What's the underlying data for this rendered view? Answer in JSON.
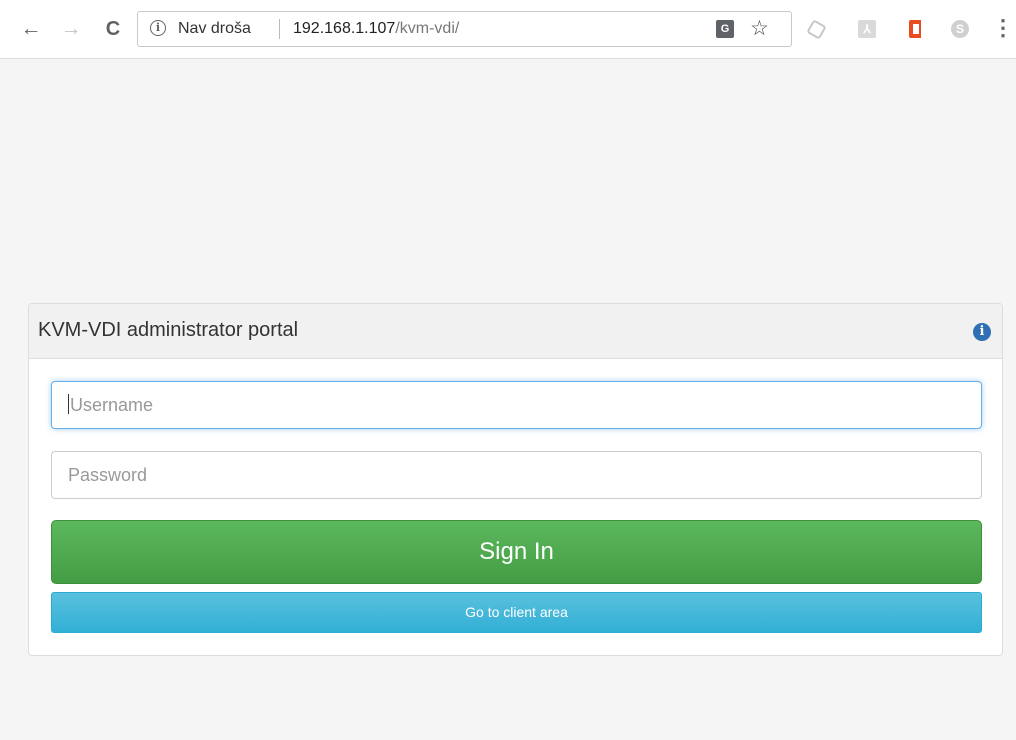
{
  "browser": {
    "back_icon": "←",
    "forward_icon": "→",
    "reload_icon": "C",
    "security_label": "Nav droša",
    "url_host": "192.168.1.107",
    "url_path": "/kvm-vdi/",
    "star_icon": "☆",
    "menu_icon": "⋮",
    "extensions": [
      "cube-extension-icon",
      "pdf-extension-icon",
      "office-extension-icon",
      "skype-extension-icon"
    ]
  },
  "panel": {
    "title": "KVM-VDI administrator portal",
    "info_icon": "i"
  },
  "form": {
    "username_placeholder": "Username",
    "username_value": "",
    "password_placeholder": "Password",
    "password_value": "",
    "signin_label": "Sign In",
    "client_area_label": "Go to client area"
  },
  "colors": {
    "signin_button": "#5cb85c",
    "client_button": "#5bc0de",
    "info_icon": "#2f6fb3",
    "focus_border": "#66afe9"
  }
}
